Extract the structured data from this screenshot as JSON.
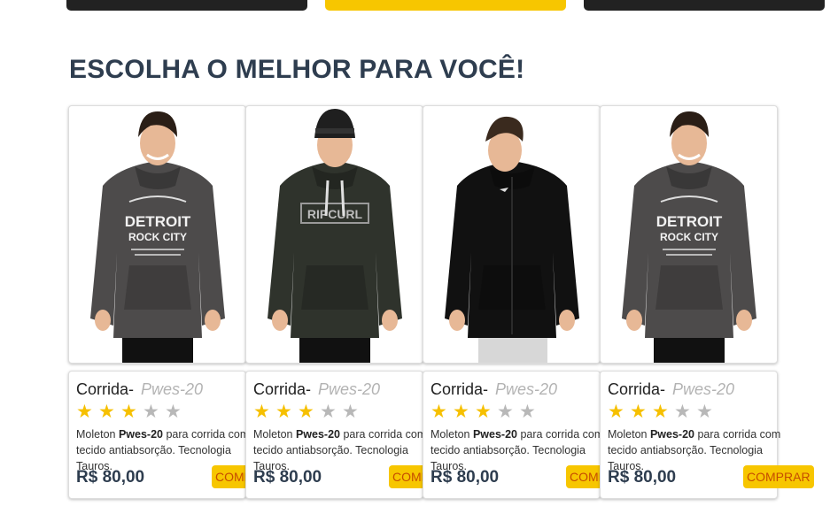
{
  "header": {
    "section_title": "ESCOLHA O MELHOR PARA VOCÊ!"
  },
  "colors": {
    "accent": "#f7c600",
    "title": "#2e3d4f",
    "button_text": "#c64d00",
    "star_on": "#f6c000",
    "star_off": "#b8b8b8"
  },
  "products": [
    {
      "title": "Corrida-",
      "model": "Pwes-20",
      "rating": 3,
      "rating_max": 5,
      "desc_before": "Moleton ",
      "desc_bold": "Pwes-20",
      "desc_after": " para corrida com tecido antiabsorção. Tecnologia Tauros.",
      "price": "R$ 80,00",
      "button_label": "COMPRAR",
      "image": {
        "style": "graphic-hoodie",
        "hoodie_color": "#4d4b4b",
        "print_text_1": "DETROIT",
        "print_text_2": "ROCK CITY"
      }
    },
    {
      "title": "Corrida-",
      "model": "Pwes-20",
      "rating": 3,
      "rating_max": 5,
      "desc_before": "Moleton ",
      "desc_bold": "Pwes-20",
      "desc_after": " para corrida com tecido antiabsorção. Tecnologia Tauros.",
      "price": "R$ 80,00",
      "button_label": "COMPRAR",
      "image": {
        "style": "brand-hoodie",
        "hoodie_color": "#2f332c",
        "print_text_1": "RIPCURL"
      }
    },
    {
      "title": "Corrida-",
      "model": "Pwes-20",
      "rating": 3,
      "rating_max": 5,
      "desc_before": "Moleton ",
      "desc_bold": "Pwes-20",
      "desc_after": " para corrida com tecido antiabsorção. Tecnologia Tauros.",
      "price": "R$ 80,00",
      "button_label": "COMPRAR",
      "image": {
        "style": "zip-hoodie",
        "hoodie_color": "#111111"
      }
    },
    {
      "title": "Corrida-",
      "model": "Pwes-20",
      "rating": 3,
      "rating_max": 5,
      "desc_before": "Moleton ",
      "desc_bold": "Pwes-20",
      "desc_after": " para corrida com tecido antiabsorção. Tecnologia Tauros.",
      "price": "R$ 80,00",
      "button_label": "COMPRAR",
      "image": {
        "style": "graphic-hoodie",
        "hoodie_color": "#4d4b4b",
        "print_text_1": "DETROIT",
        "print_text_2": "ROCK CITY"
      }
    }
  ]
}
